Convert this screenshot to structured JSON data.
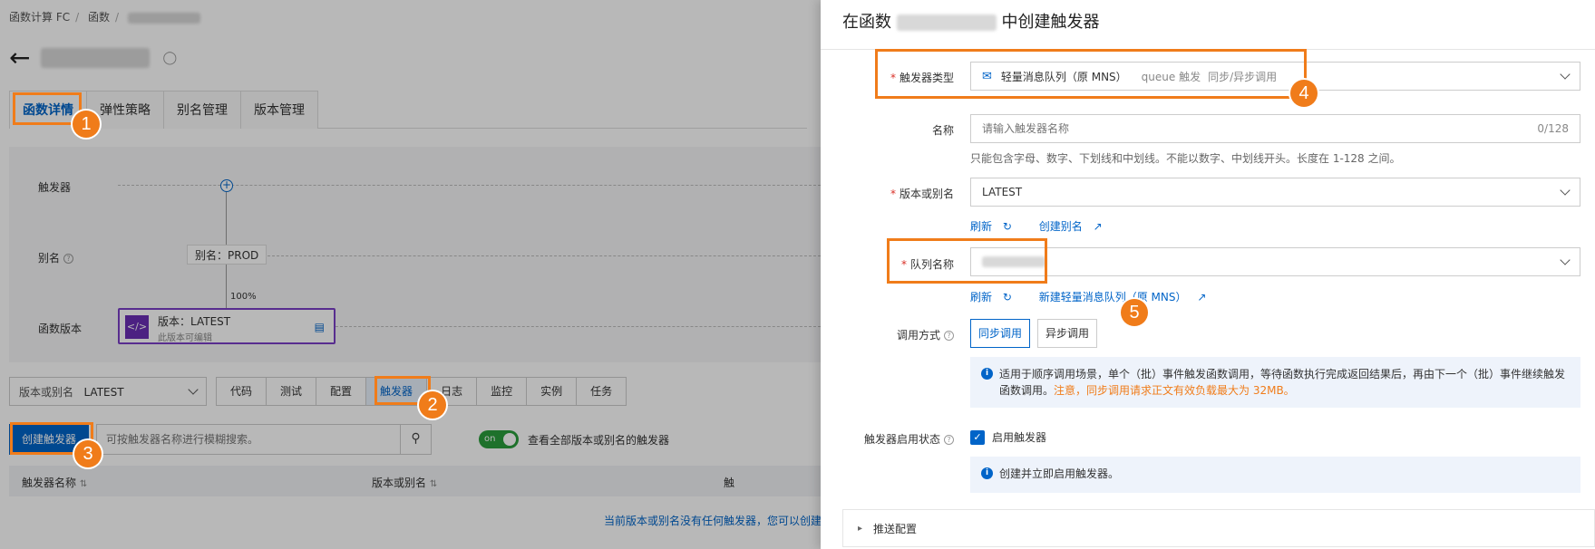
{
  "breadcrumb": [
    "函数计算 FC",
    "函数"
  ],
  "page": {
    "tabs": [
      {
        "label": "函数详情",
        "active": true
      },
      {
        "label": "弹性策略",
        "active": false
      },
      {
        "label": "别名管理",
        "active": false
      },
      {
        "label": "版本管理",
        "active": false
      }
    ]
  },
  "canvas": {
    "lane_trigger": "触发器",
    "lane_alias": "别名",
    "lane_version": "函数版本",
    "alias_node": "别名：PROD",
    "traffic_pct": "100%",
    "version_node_title": "版本：LATEST",
    "version_node_sub": "此版本可编辑",
    "version_icon": "</>"
  },
  "toolbar": {
    "version_select_label": "版本或别名",
    "version_select_value": "LATEST",
    "sub_tabs": [
      {
        "label": "代码",
        "active": false
      },
      {
        "label": "测试",
        "active": false
      },
      {
        "label": "配置",
        "active": false
      },
      {
        "label": "触发器",
        "active": true
      },
      {
        "label": "日志",
        "active": false
      },
      {
        "label": "监控",
        "active": false
      },
      {
        "label": "实例",
        "active": false
      },
      {
        "label": "任务",
        "active": false
      }
    ]
  },
  "actions": {
    "create_trigger": "创建触发器",
    "search_placeholder": "可按触发器名称进行模糊搜索。",
    "switch_on": "on",
    "switch_label": "查看全部版本或别名的触发器"
  },
  "table": {
    "col_name": "触发器名称",
    "col_version": "版本或别名",
    "col_third": "触",
    "empty": "当前版本或别名没有任何触发器，您可以创建"
  },
  "callouts": [
    "1",
    "2",
    "3",
    "4",
    "5"
  ],
  "drawer": {
    "title_prefix": "在函数",
    "title_suffix": "中创建触发器",
    "trigger_type_label": "触发器类型",
    "trigger_type_value": "轻量消息队列（原 MNS）",
    "trigger_type_tag": "queue 触发",
    "trigger_type_mode": "同步/异步调用",
    "name_label": "名称",
    "name_placeholder": "请输入触发器名称",
    "name_count": "0/128",
    "name_hint": "只能包含字母、数字、下划线和中划线。不能以数字、中划线开头。长度在 1-128 之间。",
    "version_label": "版本或别名",
    "version_value": "LATEST",
    "refresh": "刷新",
    "create_alias": "创建别名",
    "queue_label": "队列名称",
    "new_queue": "新建轻量消息队列（原 MNS）",
    "invoke_label": "调用方式",
    "invoke_sync": "同步调用",
    "invoke_async": "异步调用",
    "invoke_info": "适用于顺序调用场景，单个（批）事件触发函数调用，等待函数执行完成返回结果后，再由下一个（批）事件继续触发函数调用。",
    "invoke_warn": "注意，同步调用请求正文有效负载最大为 32MB。",
    "enable_label": "触发器启用状态",
    "enable_check": "启用触发器",
    "enable_info": "创建并立即启用触发器。",
    "push_config": "推送配置"
  }
}
